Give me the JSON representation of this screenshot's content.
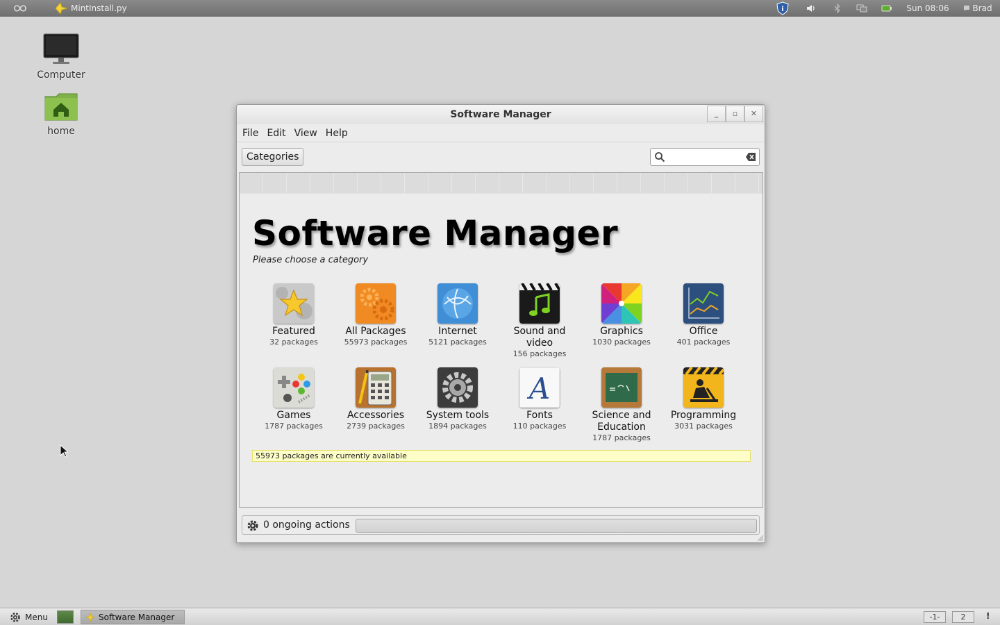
{
  "top_panel": {
    "app_launcher_label": "MintInstall.py",
    "clock": "Sun 08:06",
    "user": "Brad"
  },
  "desktop": {
    "icons": [
      {
        "label": "Computer"
      },
      {
        "label": "home"
      }
    ]
  },
  "window": {
    "title": "Software Manager",
    "menu": [
      "File",
      "Edit",
      "View",
      "Help"
    ],
    "categories_button": "Categories",
    "search": {
      "value": "",
      "placeholder": ""
    },
    "heading": "Software Manager",
    "subtitle": "Please choose a category",
    "categories": [
      {
        "name": "Featured",
        "count": "32 packages",
        "icon": "star-icon"
      },
      {
        "name": "All Packages",
        "count": "55973 packages",
        "icon": "gears-icon"
      },
      {
        "name": "Internet",
        "count": "5121 packages",
        "icon": "globe-icon"
      },
      {
        "name": "Sound and video",
        "count": "156 packages",
        "icon": "clapper-icon"
      },
      {
        "name": "Graphics",
        "count": "1030 packages",
        "icon": "color-wheel-icon"
      },
      {
        "name": "Office",
        "count": "401 packages",
        "icon": "chart-icon"
      },
      {
        "name": "Games",
        "count": "1787 packages",
        "icon": "gamepad-icon"
      },
      {
        "name": "Accessories",
        "count": "2739 packages",
        "icon": "calculator-icon"
      },
      {
        "name": "System tools",
        "count": "1894 packages",
        "icon": "gear-icon"
      },
      {
        "name": "Fonts",
        "count": "110 packages",
        "icon": "font-icon"
      },
      {
        "name": "Science and Education",
        "count": "1787 packages",
        "icon": "chalkboard-icon"
      },
      {
        "name": "Programming",
        "count": "3031 packages",
        "icon": "construction-icon"
      }
    ],
    "available_text": "55973 packages are currently available",
    "status_text": "0 ongoing actions"
  },
  "bottom_panel": {
    "menu_label": "Menu",
    "task_label": "Software Manager",
    "workspaces": [
      "-1-",
      "2"
    ],
    "alert": "!"
  },
  "colors": {
    "desktop_bg": "#d6d6d6",
    "info_bar_bg": "#fdfdc7"
  }
}
